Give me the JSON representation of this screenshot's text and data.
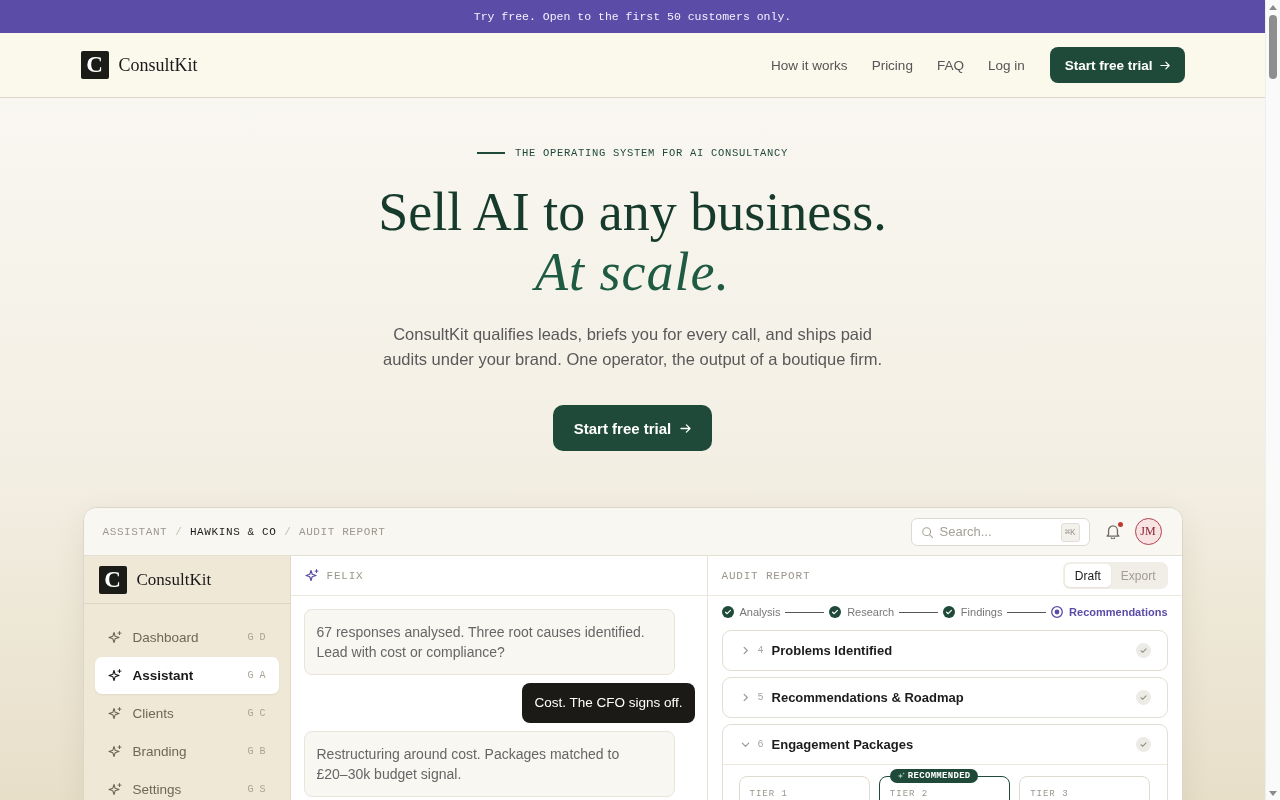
{
  "announcement": "Try free. Open to the first 50 customers only.",
  "nav": {
    "logo_mark": "C",
    "brand": "ConsultKit",
    "links": [
      "How it works",
      "Pricing",
      "FAQ",
      "Log in"
    ],
    "cta": "Start free trial"
  },
  "hero": {
    "eyebrow": "THE OPERATING SYSTEM FOR AI CONSULTANCY",
    "headline": "Sell AI to any business.",
    "headline_accent": "At scale.",
    "description": "ConsultKit qualifies leads, briefs you for every call, and ships paid audits under your brand. One operator, the output of a boutique firm.",
    "cta": "Start free trial"
  },
  "app": {
    "breadcrumb": [
      {
        "kind": "crumb",
        "label": "ASSISTANT",
        "selected": false
      },
      {
        "kind": "separator",
        "label": "/"
      },
      {
        "kind": "crumb",
        "label": "HAWKINS & CO",
        "selected": true
      },
      {
        "kind": "separator",
        "label": "/"
      },
      {
        "kind": "crumb",
        "label": "AUDIT REPORT",
        "selected": false
      }
    ],
    "search": {
      "placeholder": "Search...",
      "shortcut": "⌘K"
    },
    "notifications": {
      "unread": true
    },
    "avatar": {
      "initials": "JM"
    },
    "sidebar": {
      "logo_mark": "C",
      "brand": "ConsultKit",
      "items": [
        {
          "label": "Dashboard",
          "shortcut": "G D",
          "selected": false
        },
        {
          "label": "Assistant",
          "shortcut": "G A",
          "selected": true
        },
        {
          "label": "Clients",
          "shortcut": "G C",
          "selected": false
        },
        {
          "label": "Branding",
          "shortcut": "G B",
          "selected": false
        },
        {
          "label": "Settings",
          "shortcut": "G S",
          "selected": false
        }
      ]
    },
    "chat": {
      "title": "FELIX",
      "messages": [
        {
          "kind": "assistant",
          "text": "67 responses analysed. Three root causes identified. Lead with cost or compliance?"
        },
        {
          "kind": "user",
          "text": "Cost. The CFO signs off."
        },
        {
          "kind": "assistant",
          "text": "Restructuring around cost. Packages matched to £20–30k budget signal."
        }
      ]
    },
    "report": {
      "title": "AUDIT REPORT",
      "modes": [
        {
          "label": "Draft",
          "selected": true
        },
        {
          "label": "Export",
          "selected": false
        }
      ],
      "steps": [
        {
          "label": "Analysis",
          "done": true,
          "current": false
        },
        {
          "label": "Research",
          "done": true,
          "current": false
        },
        {
          "label": "Findings",
          "done": true,
          "current": false
        },
        {
          "label": "Recommendations",
          "done": false,
          "current": true
        }
      ],
      "sections": [
        {
          "number": "4",
          "title": "Problems Identified",
          "expanded": false,
          "complete": true
        },
        {
          "number": "5",
          "title": "Recommendations & Roadmap",
          "expanded": false,
          "complete": true
        },
        {
          "number": "6",
          "title": "Engagement Packages",
          "expanded": true,
          "complete": true,
          "packages": [
            {
              "label": "TIER 1",
              "recommended": false
            },
            {
              "label": "TIER 2",
              "recommended": true,
              "badge": "RECOMMENDED"
            },
            {
              "label": "TIER 3",
              "recommended": false
            }
          ]
        }
      ]
    }
  }
}
